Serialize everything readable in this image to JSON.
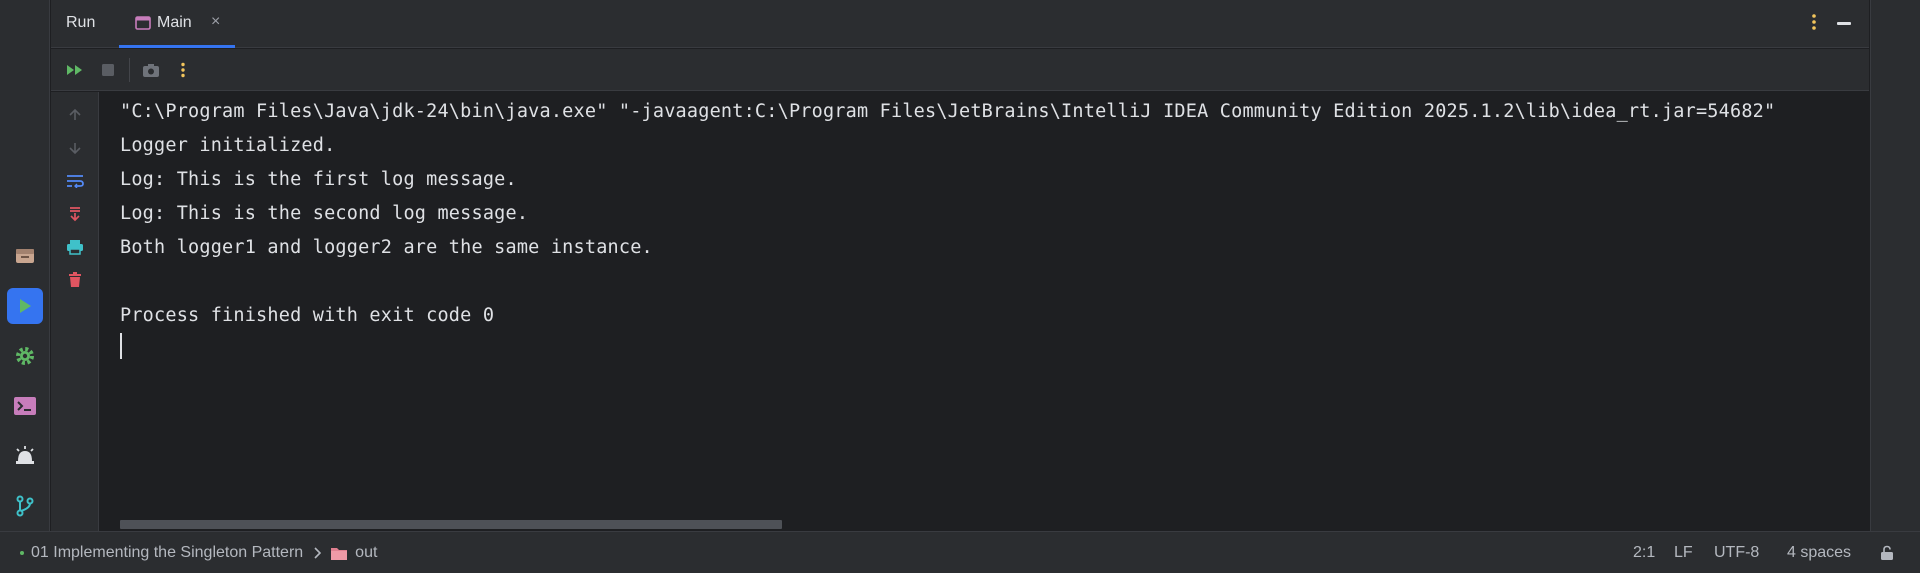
{
  "tool_window": {
    "title": "Run",
    "tab_label": "Main",
    "tab_close": "×"
  },
  "toolbar": {
    "buttons": [
      "rerun-icon",
      "stop-icon",
      "screenshot-icon",
      "more-icon"
    ]
  },
  "gutter": {
    "buttons": [
      "arrow-up-icon",
      "arrow-down-icon",
      "soft-wrap-icon",
      "scroll-to-end-icon",
      "print-icon",
      "clear-icon"
    ]
  },
  "console": {
    "lines": [
      "\"C:\\Program Files\\Java\\jdk-24\\bin\\java.exe\" \"-javaagent:C:\\Program Files\\JetBrains\\IntelliJ IDEA Community Edition 2025.1.2\\lib\\idea_rt.jar=54682\"",
      "Logger initialized.",
      "Log: This is the first log message.",
      "Log: This is the second log message.",
      "Both logger1 and logger2 are the same instance.",
      "",
      "Process finished with exit code 0"
    ]
  },
  "left_strip": {
    "buttons": [
      "project-icon",
      "run-icon",
      "services-icon",
      "terminal-icon",
      "problems-icon",
      "git-icon"
    ]
  },
  "statusbar": {
    "project": "01 Implementing the Singleton Pattern",
    "folder": "out",
    "position": "2:1",
    "line_ending": "LF",
    "encoding": "UTF-8",
    "indent": "4 spaces"
  },
  "colors": {
    "accent": "#3574f0",
    "green": "#5fb865",
    "red": "#e05561",
    "purple": "#c77dbb",
    "yellow": "#f2c55c",
    "cyan": "#3fc1c9"
  }
}
